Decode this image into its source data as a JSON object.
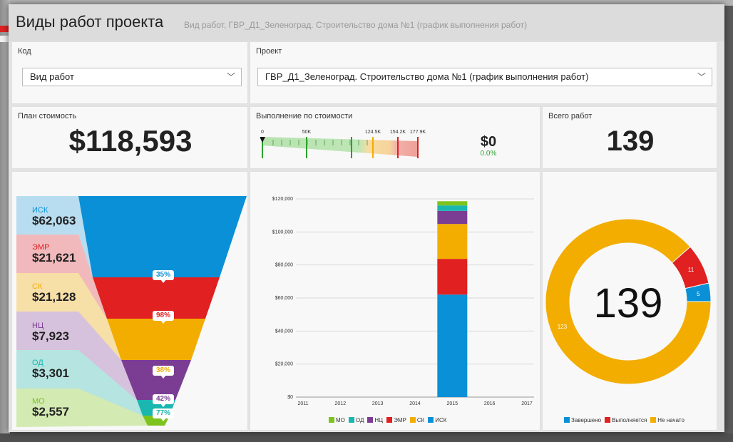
{
  "header": {
    "title": "Виды работ проекта",
    "subtitle": "Вид работ, ГВР_Д1_Зеленоград. Строительство дома №1 (график выполнения работ)"
  },
  "filters": {
    "code": {
      "label": "Код",
      "value": "Вид работ"
    },
    "project": {
      "label": "Проект",
      "value": "ГВР_Д1_Зеленоград. Строительство дома №1 (график выполнения работ)"
    }
  },
  "kpi": {
    "plan_cost": {
      "label": "План стоимость",
      "value": "$118,593"
    },
    "progress": {
      "label": "Выполнение по стоимости",
      "value": "$0",
      "percent": "0.0%",
      "scale_labels": [
        "0",
        "50K",
        "124.5K",
        "154.2K",
        "177.9K"
      ],
      "current_fraction": 0
    },
    "total_works": {
      "label": "Всего работ",
      "value": "139"
    }
  },
  "icons": {
    "dropdown": "chevron-down-icon",
    "marker": "triangle-marker-icon"
  },
  "colors": {
    "ИСК": "#0a90d6",
    "ЭМР": "#e02021",
    "СК": "#f2ad00",
    "НЦ": "#7b3d93",
    "ОД": "#1ab6b0",
    "МО": "#7dc31e"
  },
  "funnel": {
    "items": [
      {
        "name": "ИСК",
        "value": "$62,063"
      },
      {
        "name": "ЭМР",
        "value": "$21,621"
      },
      {
        "name": "СК",
        "value": "$21,128"
      },
      {
        "name": "НЦ",
        "value": "$7,923"
      },
      {
        "name": "ОД",
        "value": "$3,301"
      },
      {
        "name": "МО",
        "value": "$2,557"
      }
    ],
    "percents": [
      "35%",
      "98%",
      "38%",
      "42%",
      "77%"
    ]
  },
  "chart_data": [
    {
      "type": "bar",
      "stacked": true,
      "categories": [
        "2011",
        "2012",
        "2013",
        "2014",
        "2015",
        "2016",
        "2017"
      ],
      "series": [
        {
          "name": "МО",
          "values": [
            0,
            0,
            0,
            0,
            2557,
            0,
            0
          ]
        },
        {
          "name": "ОД",
          "values": [
            0,
            0,
            0,
            0,
            3301,
            0,
            0
          ]
        },
        {
          "name": "НЦ",
          "values": [
            0,
            0,
            0,
            0,
            7923,
            0,
            0
          ]
        },
        {
          "name": "ЭМР",
          "values": [
            0,
            0,
            0,
            0,
            21621,
            0,
            0
          ]
        },
        {
          "name": "СК",
          "values": [
            0,
            0,
            0,
            0,
            21128,
            0,
            0
          ]
        },
        {
          "name": "ИСК",
          "values": [
            0,
            0,
            0,
            0,
            62063,
            0,
            0
          ]
        }
      ],
      "stack_order_bottom_to_top": [
        "ИСК",
        "ЭМР",
        "СК",
        "НЦ",
        "ОД",
        "МО"
      ],
      "yticks": [
        "$0",
        "$20,000",
        "$40,000",
        "$60,000",
        "$80,000",
        "$100,000",
        "$120,000"
      ],
      "ylim": [
        0,
        120000
      ],
      "grid": true,
      "legend": "bottom",
      "legend_items": [
        "МО",
        "ОД",
        "НЦ",
        "ЭМР",
        "СК",
        "ИСК"
      ]
    },
    {
      "type": "pie",
      "donut": true,
      "center_label": "139",
      "slices": [
        {
          "name": "Завершено",
          "value": 5,
          "label": "5",
          "color": "#0a90d6"
        },
        {
          "name": "Выполняется",
          "value": 11,
          "label": "11",
          "color": "#e02021"
        },
        {
          "name": "Не начато",
          "value": 123,
          "label": "123",
          "color": "#f2ad00"
        }
      ],
      "legend": "bottom"
    }
  ]
}
